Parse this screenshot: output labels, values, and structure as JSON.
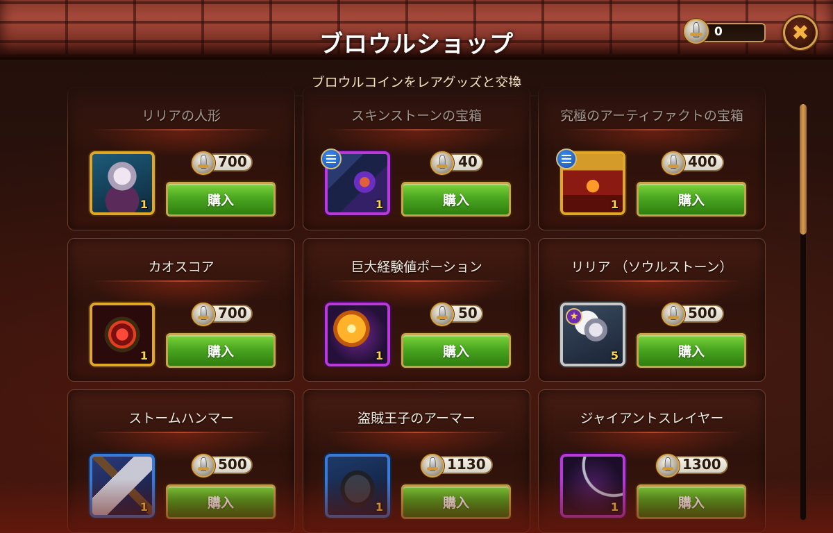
{
  "header": {
    "title": "ブロウルショップ",
    "subtitle": "ブロウルコインをレアグッズと交換",
    "currency_amount": "0",
    "close_label": "✖"
  },
  "shop": {
    "items": [
      {
        "name": "リリアの人形",
        "price": "700",
        "quantity": "1",
        "buy_label": "購入",
        "frame": "gold",
        "icon": "doll-icon",
        "badge": ""
      },
      {
        "name": "スキンストーンの宝箱",
        "price": "40",
        "quantity": "1",
        "buy_label": "購入",
        "frame": "purple",
        "icon": "skin-stone-chest-icon",
        "badge": "list"
      },
      {
        "name": "究極のアーティファクトの宝箱",
        "price": "400",
        "quantity": "1",
        "buy_label": "購入",
        "frame": "gold",
        "icon": "artifact-chest-icon",
        "badge": "list"
      },
      {
        "name": "カオスコア",
        "price": "700",
        "quantity": "1",
        "buy_label": "購入",
        "frame": "gold",
        "icon": "chaos-core-icon",
        "badge": ""
      },
      {
        "name": "巨大経験値ポーション",
        "price": "50",
        "quantity": "1",
        "buy_label": "購入",
        "frame": "purple",
        "icon": "potion-icon",
        "badge": ""
      },
      {
        "name": "リリア （ソウルストーン）",
        "price": "500",
        "quantity": "5",
        "buy_label": "購入",
        "frame": "white",
        "icon": "hero-portrait-icon",
        "badge": "star"
      },
      {
        "name": "ストームハンマー",
        "price": "500",
        "quantity": "1",
        "buy_label": "購入",
        "frame": "blue",
        "icon": "hammer-icon",
        "badge": ""
      },
      {
        "name": "盗賊王子のアーマー",
        "price": "1130",
        "quantity": "1",
        "buy_label": "購入",
        "frame": "blue",
        "icon": "armor-icon",
        "badge": ""
      },
      {
        "name": "ジャイアントスレイヤー",
        "price": "1300",
        "quantity": "1",
        "buy_label": "購入",
        "frame": "purple",
        "icon": "bow-icon",
        "badge": ""
      }
    ]
  },
  "colors": {
    "buy_button": "#4aa720",
    "frame_gold": "#e0a826",
    "frame_purple": "#b93ad8",
    "frame_blue": "#3c7ad6",
    "accent": "#d6a24f"
  }
}
